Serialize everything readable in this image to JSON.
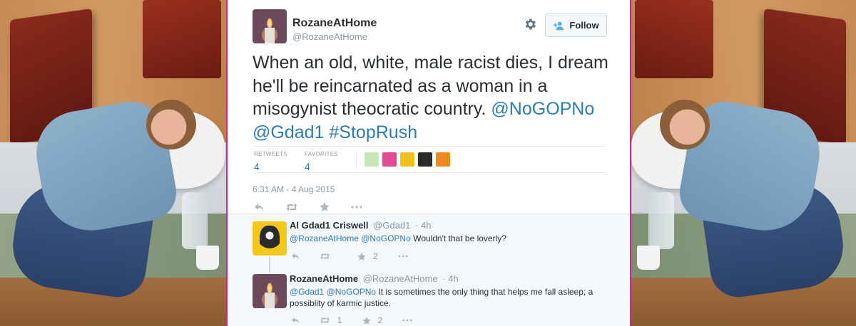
{
  "tweet": {
    "author_name": "RozaneAtHome",
    "author_handle": "@RozaneAtHome",
    "follow_label": "Follow",
    "text_plain": "When an old, white, male racist dies, I dream he'll be reincarnated as a woman in a misogynist theocratic country.",
    "mentions": [
      "@NoGOPNo",
      "@Gdad1",
      "#StopRush"
    ],
    "retweets_label": "RETWEETS",
    "retweets_count": "4",
    "favorites_label": "FAVORITES",
    "favorites_count": "4",
    "timestamp": "6:31 AM - 4 Aug 2015",
    "favoriter_colors": [
      "#c9e6b6",
      "#e24a8f",
      "#f0c21b",
      "#2b2b2b",
      "#f08a1e"
    ]
  },
  "replies": [
    {
      "name": "Al Gdad1 Criswell",
      "handle": "@Gdad1",
      "time": "· 4h",
      "mentions": "@RozaneAtHome @NoGOPNo",
      "text": "Wouldn't that be loverly?",
      "retweets": "",
      "favorites": "2"
    },
    {
      "name": "RozaneAtHome",
      "handle": "@RozaneAtHome",
      "time": "· 4h",
      "mentions": "@Gdad1 @NoGOPNo",
      "text": "It is sometimes the only thing that helps me fall asleep; a possiblity of karmic justice.",
      "retweets": "1",
      "favorites": "2"
    }
  ],
  "colors": {
    "frame": "#d9228f",
    "link": "#2b7bb9",
    "text": "#292f33",
    "muted": "#8899a6"
  },
  "icons": [
    "gear-icon",
    "follow-icon",
    "reply-icon",
    "retweet-icon",
    "favorite-icon",
    "more-icon"
  ]
}
